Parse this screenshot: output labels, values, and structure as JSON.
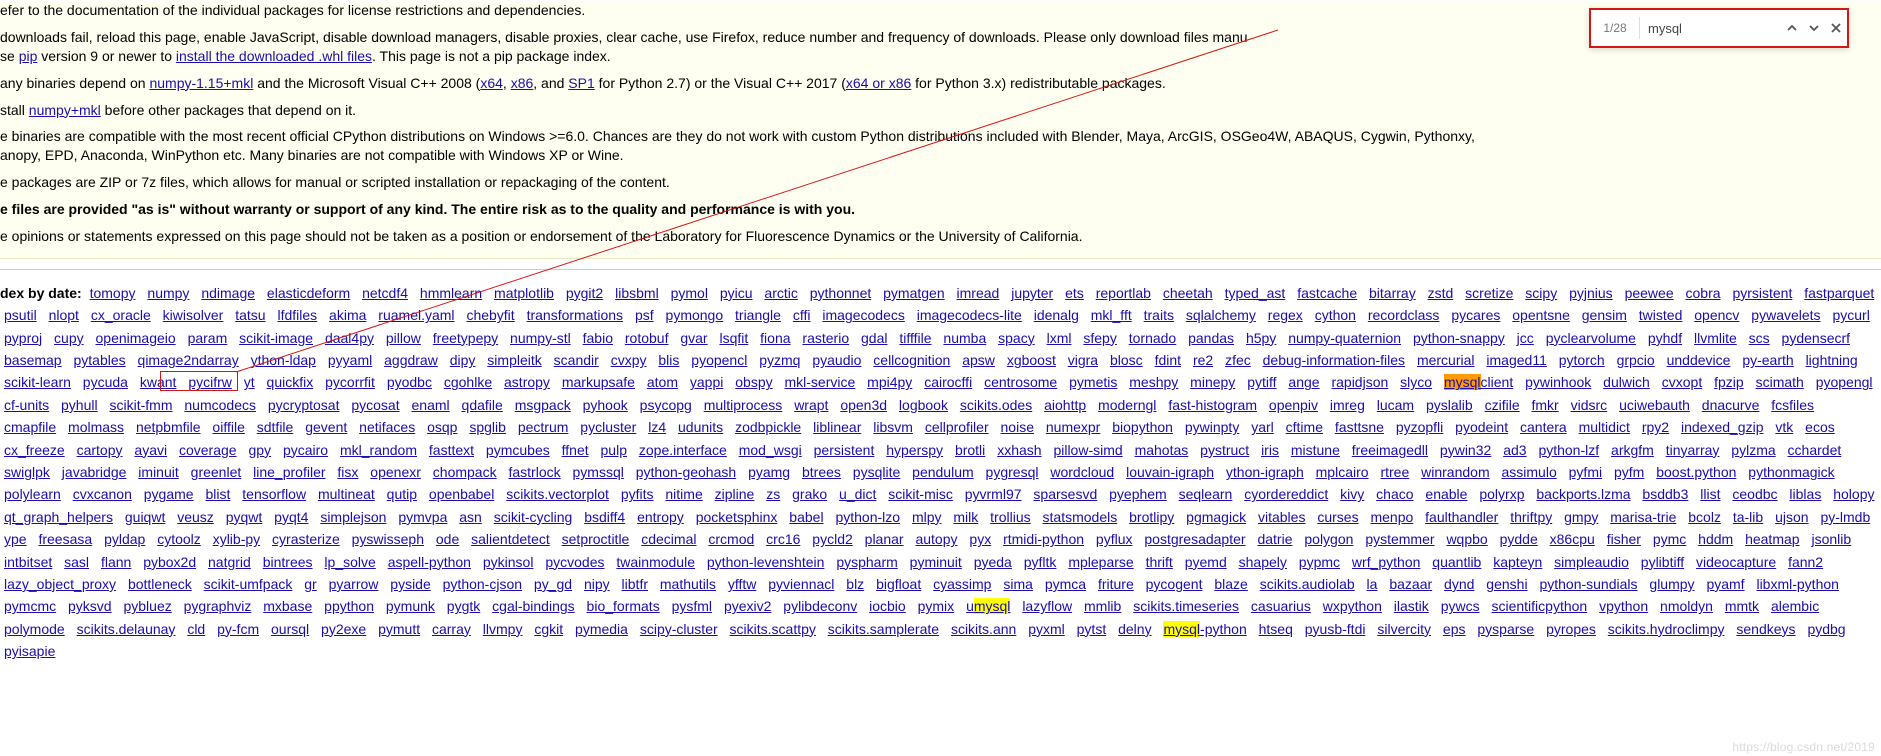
{
  "find": {
    "count": "1/28",
    "query": "mysql"
  },
  "intro": {
    "p1": "efer to the documentation of the individual packages for license restrictions and dependencies.",
    "p2a": "downloads fail, reload this page, enable JavaScript, disable download managers, disable proxies, clear cache, use Firefox, reduce number and frequency of downloads. Please only download files manu",
    "p2b": "se ",
    "p2_pip": "pip",
    "p2c": " version 9 or newer to ",
    "p2_install": "install the downloaded .whl files",
    "p2d": ". This page is not a pip package index.",
    "p3a": "any binaries depend on ",
    "p3_numpy": "numpy-1.15+mkl",
    "p3b": " and the Microsoft Visual C++ 2008 (",
    "p3_x64": "x64",
    "p3c": ", ",
    "p3_x86": "x86",
    "p3d": ", and ",
    "p3_sp1": "SP1",
    "p3e": " for Python 2.7) or the Visual C++ 2017 (",
    "p3_x64x86": "x64 or x86",
    "p3f": " for Python 3.x) redistributable packages.",
    "p4a": "stall ",
    "p4_numpy": "numpy+mkl",
    "p4b": " before other packages that depend on it.",
    "p5a": "e binaries are compatible with the most recent official CPython distributions on Windows >=6.0. Chances are they do not work with custom Python distributions included with Blender, Maya, ArcGIS, OSGeo4W, ABAQUS, Cygwin, Pythonxy,",
    "p5b": "anopy, EPD, Anaconda, WinPython etc. Many binaries are not compatible with Windows XP or Wine.",
    "p6": "e packages are ZIP or 7z files, which allows for manual or scripted installation or repackaging of the content.",
    "p7": "e files are provided \"as is\" without warranty or support of any kind. The entire risk as to the quality and performance is with you.",
    "p8": "e opinions or statements expressed on this page should not be taken as a position or endorsement of the Laboratory for Fluorescence Dynamics or the University of California."
  },
  "index_header": "dex by date:",
  "packages": [
    "tomopy",
    "numpy",
    "ndimage",
    "elasticdeform",
    "netcdf4",
    "hmmlearn",
    "matplotlib",
    "pygit2",
    "libsbml",
    "pymol",
    "pyicu",
    "arctic",
    "pythonnet",
    "pymatgen",
    "imread",
    "jupyter",
    "ets",
    "reportlab",
    "cheetah",
    "typed_ast",
    "fastcache",
    "bitarray",
    "zstd",
    "scretize",
    "scipy",
    "pyjnius",
    "peewee",
    "cobra",
    "pyrsistent",
    "fastparquet",
    "psutil",
    "nlopt",
    "cx_oracle",
    "kiwisolver",
    "tatsu",
    "lfdfiles",
    "akima",
    "ruamel.yaml",
    "chebyfit",
    "transformations",
    "psf",
    "pymongo",
    "triangle",
    "cffi",
    "imagecodecs",
    "imagecodecs-lite",
    "idenalg",
    "mkl_fft",
    "traits",
    "sqlalchemy",
    "regex",
    "cython",
    "recordclass",
    "pycares",
    "opentsne",
    "gensim",
    "twisted",
    "opencv",
    "pywavelets",
    "pycurl",
    "pyproj",
    "cupy",
    "openimageio",
    "param",
    "scikit-image",
    "daal4py",
    "pillow",
    "freetypepy",
    "numpy-stl",
    "fabio",
    "rotobuf",
    "gvar",
    "lsqfit",
    "fiona",
    "rasterio",
    "gdal",
    "tifffile",
    "numba",
    "spacy",
    "lxml",
    "sfepy",
    "tornado",
    "pandas",
    "h5py",
    "numpy-quaternion",
    "python-snappy",
    "jcc",
    "pyclearvolume",
    "pyhdf",
    "llvmlite",
    "scs",
    "pydensecrf",
    "basemap",
    "pytables",
    "qimage2ndarray",
    "ython-ldap",
    "pyyaml",
    "aggdraw",
    "dipy",
    "simpleitk",
    "scandir",
    "cvxpy",
    "blis",
    "pyopencl",
    "pyzmq",
    "pyaudio",
    "cellcognition",
    "apsw",
    "xgboost",
    "vigra",
    "blosc",
    "fdint",
    "re2",
    "zfec",
    "debug-information-files",
    "mercurial",
    "imaged11",
    "pytorch",
    "grpcio",
    "unddevice",
    "py-earth",
    "lightning",
    "scikit-learn",
    "pycuda",
    "kwant",
    "pycifrw",
    "yt",
    "quickfix",
    "pycorrfit",
    "pyodbc",
    "cgohlke",
    "astropy",
    "markupsafe",
    "atom",
    "yappi",
    "obspy",
    "mkl-service",
    "mpi4py",
    "cairocffi",
    "centrosome",
    "pymetis",
    "meshpy",
    "minepy",
    "pytiff",
    "ange",
    "rapidjson",
    "slyco",
    "mysqlclient",
    "pywinhook",
    "dulwich",
    "cvxopt",
    "fpzip",
    "scimath",
    "pyopengl",
    "cf-units",
    "pyhull",
    "scikit-fmm",
    "numcodecs",
    "pycryptosat",
    "pycosat",
    "enaml",
    "qdafile",
    "msgpack",
    "pyhook",
    "psycopg",
    "multiprocess",
    "wrapt",
    "open3d",
    "logbook",
    "scikits.odes",
    "aiohttp",
    "moderngl",
    "fast-histogram",
    "openpiv",
    "imreg",
    "lucam",
    "pyslalib",
    "czifile",
    "fmkr",
    "vidsrc",
    "uciwebauth",
    "dnacurve",
    "fcsfiles",
    "cmapfile",
    "molmass",
    "netpbmfile",
    "oiffile",
    "sdtfile",
    "gevent",
    "netifaces",
    "osqp",
    "spglib",
    "pectrum",
    "pycluster",
    "lz4",
    "udunits",
    "zodbpickle",
    "liblinear",
    "libsvm",
    "cellprofiler",
    "noise",
    "numexpr",
    "biopython",
    "pywinpty",
    "yarl",
    "cftime",
    "fasttsne",
    "pyzopfli",
    "pyodeint",
    "cantera",
    "multidict",
    "rpy2",
    "indexed_gzip",
    "vtk",
    "ecos",
    "cx_freeze",
    "cartopy",
    "ayavi",
    "coverage",
    "gpy",
    "pycairo",
    "mkl_random",
    "fasttext",
    "pymcubes",
    "ffnet",
    "pulp",
    "zope.interface",
    "mod_wsgi",
    "persistent",
    "hyperspy",
    "brotli",
    "xxhash",
    "pillow-simd",
    "mahotas",
    "pystruct",
    "iris",
    "mistune",
    "freeimagedll",
    "pywin32",
    "ad3",
    "python-lzf",
    "arkgfm",
    "tinyarray",
    "pylzma",
    "cchardet",
    "swiglpk",
    "javabridge",
    "iminuit",
    "greenlet",
    "line_profiler",
    "fisx",
    "openexr",
    "chompack",
    "fastrlock",
    "pymssql",
    "python-geohash",
    "pyamg",
    "btrees",
    "pysqlite",
    "pendulum",
    "pygresql",
    "wordcloud",
    "louvain-igraph",
    "ython-igraph",
    "mplcairo",
    "rtree",
    "winrandom",
    "assimulo",
    "pyfmi",
    "pyfm",
    "boost.python",
    "pythonmagick",
    "polylearn",
    "cvxcanon",
    "pygame",
    "blist",
    "tensorflow",
    "multineat",
    "qutip",
    "openbabel",
    "scikits.vectorplot",
    "pyfits",
    "nitime",
    "zipline",
    "zs",
    "grako",
    "u_dict",
    "scikit-misc",
    "pyvrml97",
    "sparsesvd",
    "pyephem",
    "seqlearn",
    "cyordereddict",
    "kivy",
    "chaco",
    "enable",
    "polyrxp",
    "backports.lzma",
    "bsddb3",
    "llist",
    "ceodbc",
    "liblas",
    "holopy",
    "qt_graph_helpers",
    "guiqwt",
    "veusz",
    "pyqwt",
    "pyqt4",
    "simplejson",
    "pymvpa",
    "asn",
    "scikit-cycling",
    "bsdiff4",
    "entropy",
    "pocketsphinx",
    "babel",
    "python-lzo",
    "mlpy",
    "milk",
    "trollius",
    "statsmodels",
    "brotlipy",
    "pgmagick",
    "vitables",
    "curses",
    "menpo",
    "faulthandler",
    "thriftpy",
    "gmpy",
    "marisa-trie",
    "bcolz",
    "ta-lib",
    "ujson",
    "py-lmdb",
    "ype",
    "freesasa",
    "pyldap",
    "cytoolz",
    "xylib-py",
    "cyrasterize",
    "pyswisseph",
    "ode",
    "salientdetect",
    "setproctitle",
    "cdecimal",
    "crcmod",
    "crc16",
    "pycld2",
    "planar",
    "autopy",
    "pyx",
    "rtmidi-python",
    "pyflux",
    "postgresadapter",
    "datrie",
    "polygon",
    "pystemmer",
    "wqpbo",
    "pydde",
    "x86cpu",
    "fisher",
    "pymc",
    "hddm",
    "heatmap",
    "jsonlib",
    "intbitset",
    "sasl",
    "flann",
    "pybox2d",
    "natgrid",
    "bintrees",
    "lp_solve",
    "aspell-python",
    "pykinsol",
    "pycvodes",
    "twainmodule",
    "python-levenshtein",
    "pyspharm",
    "pyminuit",
    "pyeda",
    "pyfltk",
    "mpleparse",
    "thrift",
    "pyemd",
    "shapely",
    "pypmc",
    "wrf_python",
    "quantlib",
    "kapteyn",
    "simpleaudio",
    "pylibtiff",
    "videocapture",
    "fann2",
    "lazy_object_proxy",
    "bottleneck",
    "scikit-umfpack",
    "gr",
    "pyarrow",
    "pyside",
    "python-cjson",
    "py_gd",
    "nipy",
    "libtfr",
    "mathutils",
    "yfftw",
    "pyviennacl",
    "blz",
    "bigfloat",
    "cyassimp",
    "sima",
    "pymca",
    "friture",
    "pycogent",
    "blaze",
    "scikits.audiolab",
    "la",
    "bazaar",
    "dynd",
    "genshi",
    "python-sundials",
    "glumpy",
    "pyamf",
    "libxml-python",
    "pymcmc",
    "pyksvd",
    "pybluez",
    "pygraphviz",
    "mxbase",
    "ppython",
    "pymunk",
    "pygtk",
    "cgal-bindings",
    "bio_formats",
    "pysfml",
    "pyexiv2",
    "pylibdeconv",
    "iocbio",
    "pymix",
    "umysql",
    "lazyflow",
    "mmlib",
    "scikits.timeseries",
    "casuarius",
    "wxpython",
    "ilastik",
    "pywcs",
    "scientificpython",
    "vpython",
    "nmoldyn",
    "mmtk",
    "alembic",
    "polymode",
    "scikits.delaunay",
    "cld",
    "py-fcm",
    "oursql",
    "py2exe",
    "pymutt",
    "carray",
    "llvmpy",
    "cgkit",
    "pymedia",
    "scipy-cluster",
    "scikits.scattpy",
    "scikits.samplerate",
    "scikits.ann",
    "pyxml",
    "pytst",
    "delny",
    "mysql-python",
    "htseq",
    "pyusb-ftdi",
    "silvercity",
    "eps",
    "pysparse",
    "pyropes",
    "scikits.hydroclimpy",
    "sendkeys",
    "pydbg",
    "pyisapie"
  ],
  "highlight": {
    "current_match": "mysqlclient",
    "other_matches": [
      "umysql",
      "mysql-python",
      "pymssql"
    ]
  },
  "watermark": "https://blog.csdn.net/2019"
}
